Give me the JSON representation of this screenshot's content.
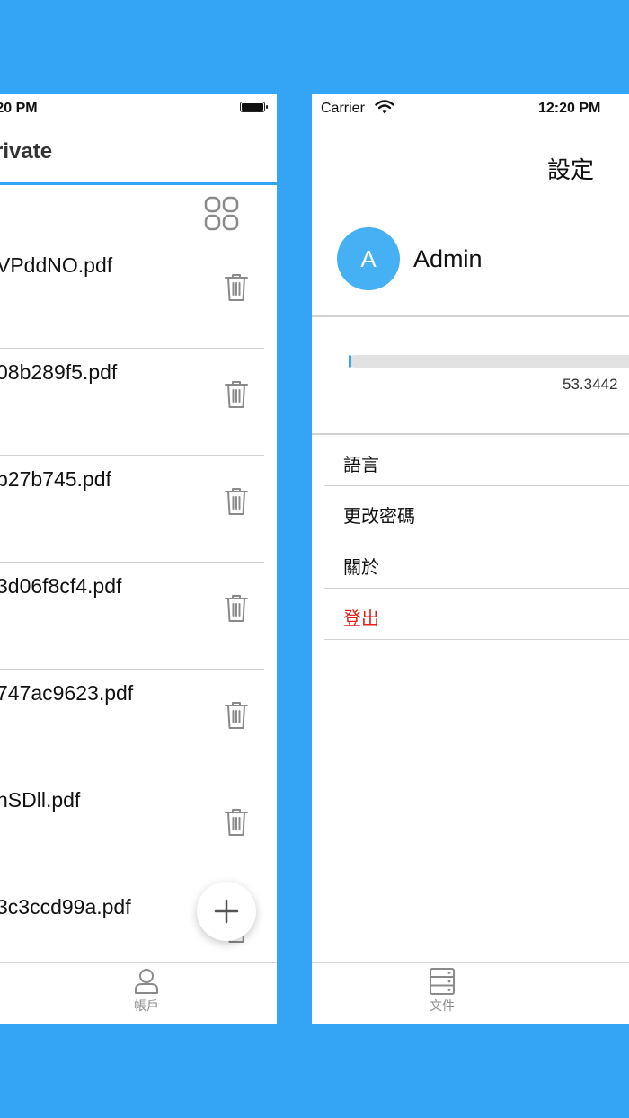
{
  "left_screen": {
    "status_time": ":20 PM",
    "title": "rivate",
    "files": [
      {
        "name": "VPddNO.pdf"
      },
      {
        "name": "08b289f5.pdf"
      },
      {
        "name": "b27b745.pdf"
      },
      {
        "name": "3d06f8cf4.pdf"
      },
      {
        "name": "747ac9623.pdf"
      },
      {
        "name": "nSDll.pdf"
      },
      {
        "name": "3c3ccd99a.pdf"
      }
    ],
    "tab_bar": {
      "account_label": "帳戶"
    }
  },
  "right_screen": {
    "carrier": "Carrier",
    "status_time": "12:20 PM",
    "title": "設定",
    "avatar_letter": "A",
    "user_name": "Admin",
    "storage": {
      "text": "53.3442",
      "fraction": 0.01
    },
    "menu": [
      {
        "label": "語言"
      },
      {
        "label": "更改密碼"
      },
      {
        "label": "關於"
      },
      {
        "label": "登出"
      }
    ],
    "tab_bar": {
      "files_label": "文件"
    }
  },
  "colors": {
    "accent": "#33a5f4",
    "avatar": "#45b0f4",
    "danger": "#e2231a",
    "divider": "#d2d2d2",
    "icon_gray": "#8a8a8a"
  }
}
